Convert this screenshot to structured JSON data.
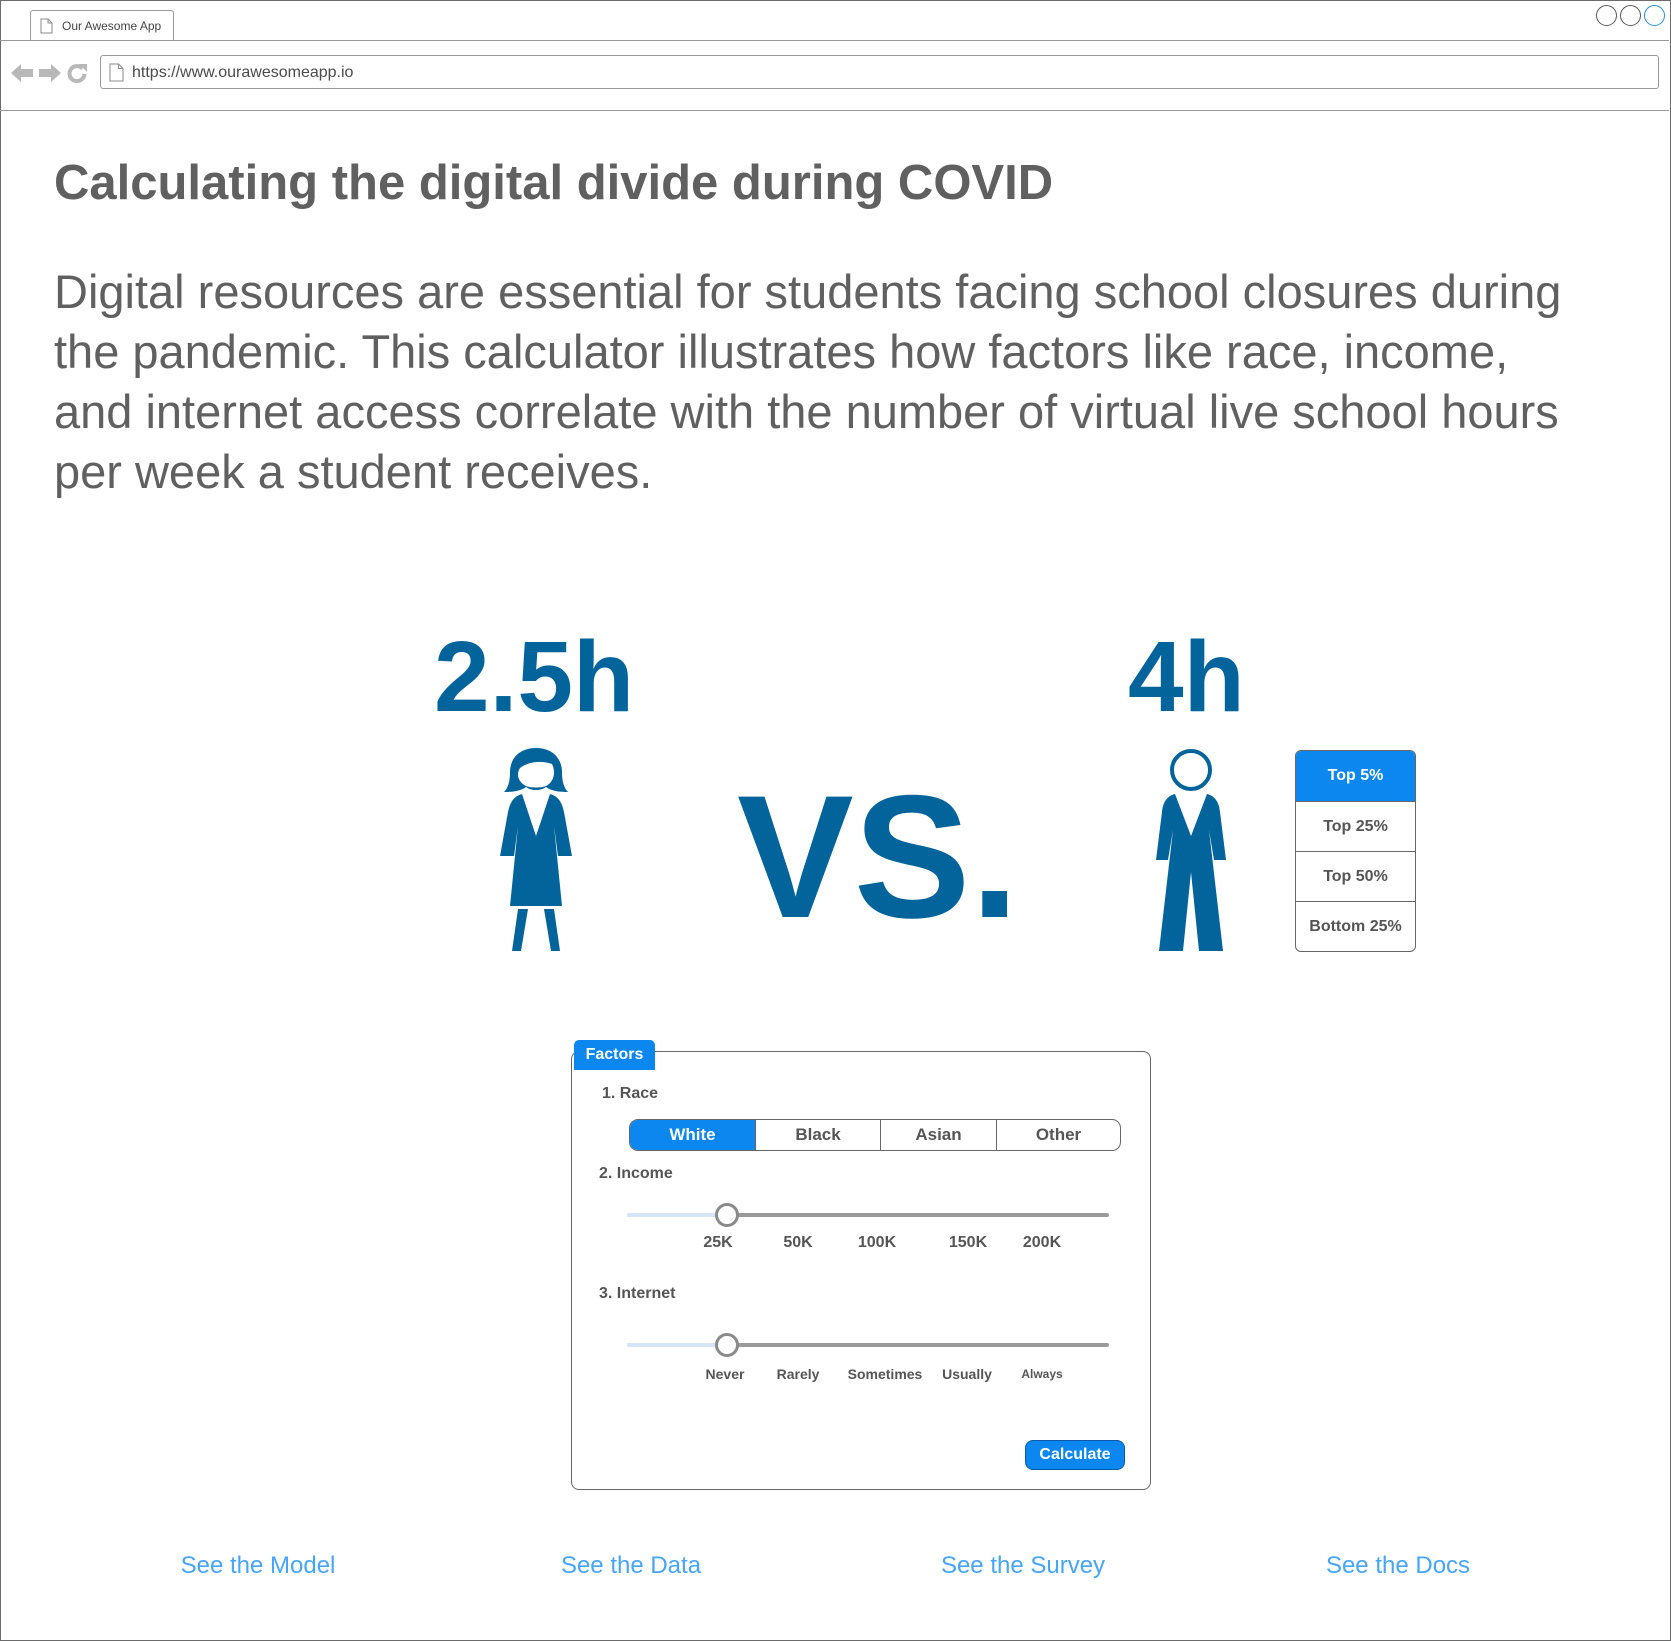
{
  "browser": {
    "tab_title": "Our Awesome App",
    "url": "https://www.ourawesomeapp.io"
  },
  "main": {
    "title": "Calculating the digital divide during COVID",
    "intro": "Digital resources are essential for students facing school closures during the pandemic. This calculator illustrates how factors like race, income, and internet access correlate with the number of virtual live school hours per week a student receives.",
    "left_hours": "2.5h",
    "right_hours": "4h",
    "vs": "VS."
  },
  "rank_selector": {
    "items": [
      "Top 5%",
      "Top 25%",
      "Top 50%",
      "Bottom 25%"
    ],
    "selected": "Top 5%"
  },
  "factors": {
    "tab_label": "Factors",
    "race": {
      "label": "1. Race",
      "options": [
        "White",
        "Black",
        "Asian",
        "Other"
      ],
      "selected": "White"
    },
    "income": {
      "label": "2. Income",
      "ticks": [
        "25K",
        "50K",
        "100K",
        "150K",
        "200K"
      ],
      "value": "25K"
    },
    "internet": {
      "label": "3. Internet",
      "ticks": [
        "Never",
        "Rarely",
        "Sometimes",
        "Usually",
        "Always"
      ],
      "value": "Never"
    },
    "calculate_label": "Calculate"
  },
  "footer": {
    "links": [
      "See the Model",
      "See the Data",
      "See the Survey",
      "See the Docs"
    ]
  },
  "colors": {
    "accent": "#0b87ef",
    "figure_blue": "#03639b",
    "link": "#46a5f7",
    "text": "#606060"
  }
}
